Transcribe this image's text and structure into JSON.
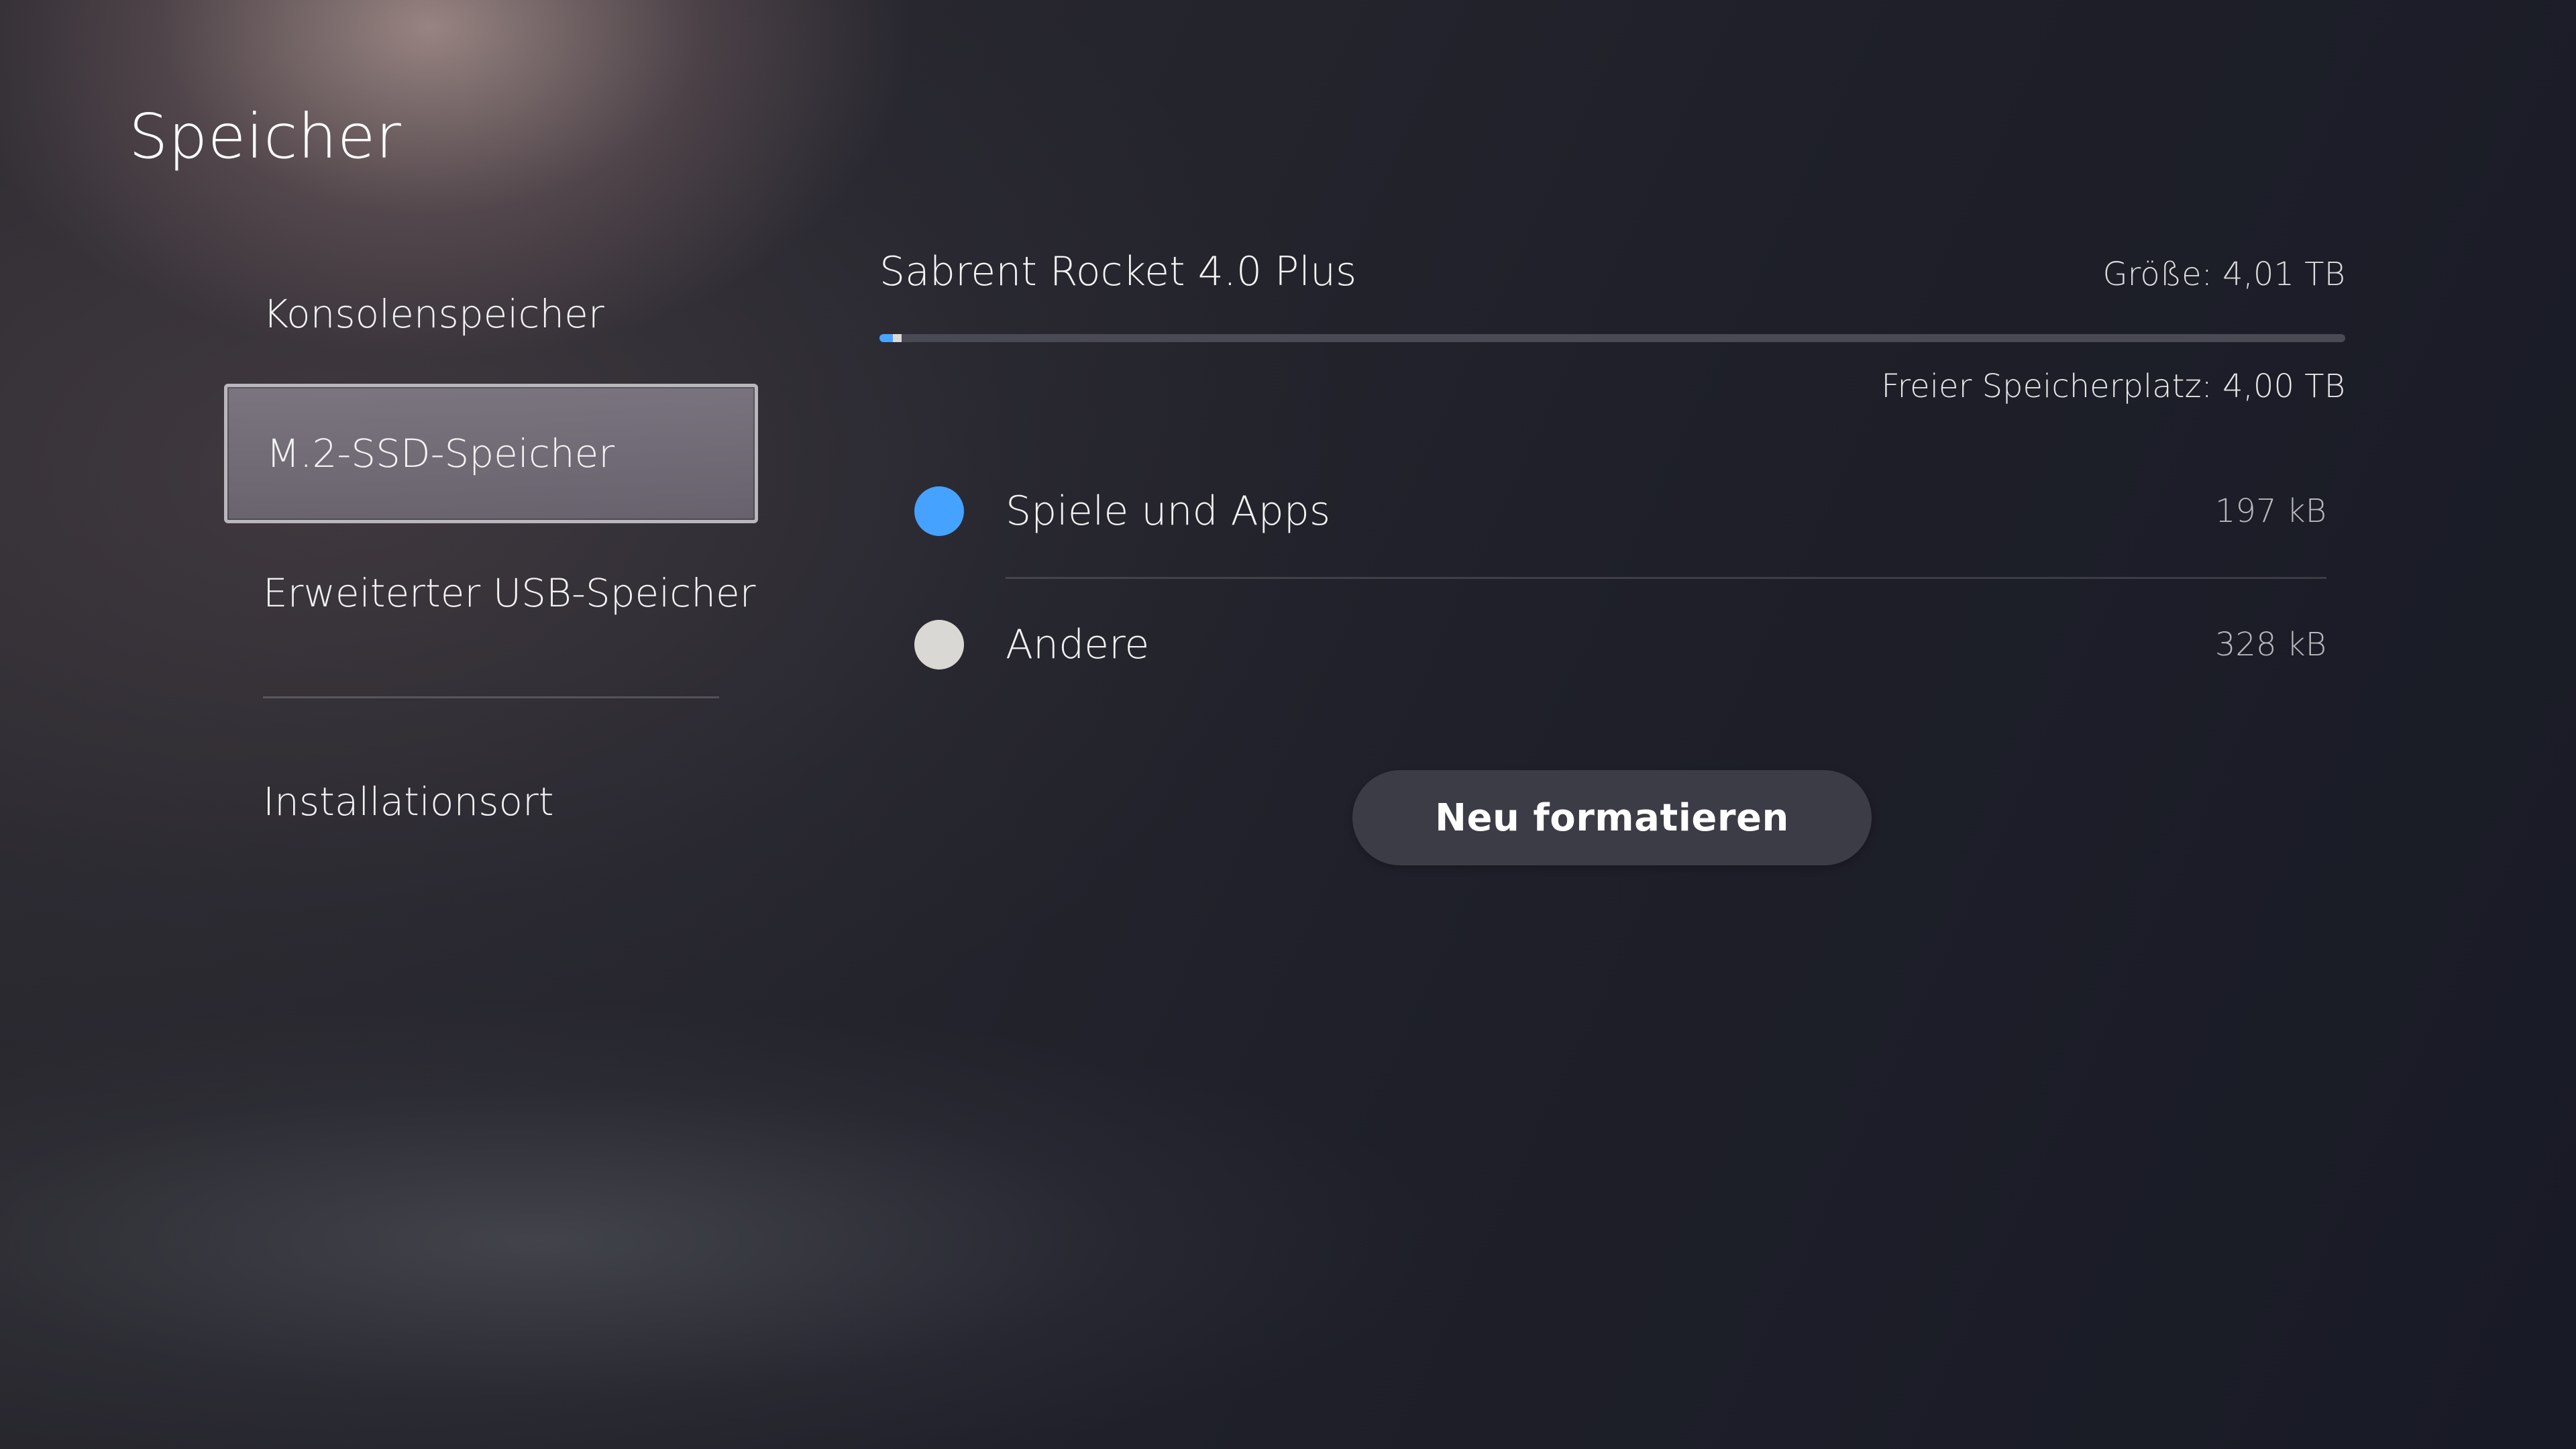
{
  "page": {
    "title": "Speicher"
  },
  "sidebar": {
    "items": [
      {
        "label": "Konsolenspeicher",
        "selected": false
      },
      {
        "label": "M.2-SSD-Speicher",
        "selected": true
      },
      {
        "label": "Erweiterter USB-Speicher",
        "selected": false
      },
      {
        "label": "Installationsort",
        "selected": false
      }
    ]
  },
  "drive": {
    "name": "Sabrent Rocket 4.0 Plus",
    "size_label": "Größe: 4,01 TB",
    "free_label": "Freier Speicherplatz: 4,00 TB",
    "usage_segments": [
      {
        "category": "Spiele und Apps",
        "fraction": 0.009,
        "color": "#4aa3ff"
      },
      {
        "category": "Andere",
        "fraction": 0.006,
        "color": "#dcdad6"
      }
    ],
    "track_color": "#4a4a55"
  },
  "categories": [
    {
      "label": "Spiele und Apps",
      "value": "197 kB",
      "color": "#45a2ff"
    },
    {
      "label": "Andere",
      "value": "328 kB",
      "color": "#dad8d4"
    }
  ],
  "actions": {
    "format_label": "Neu formatieren"
  }
}
